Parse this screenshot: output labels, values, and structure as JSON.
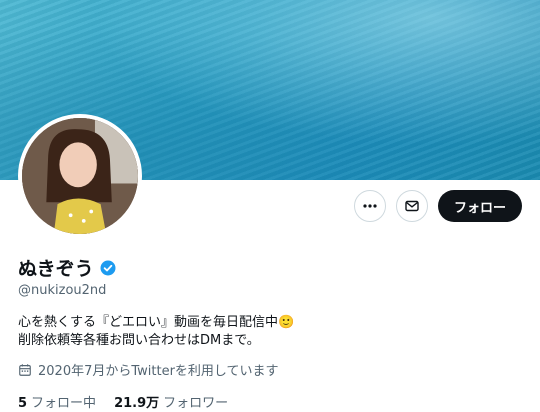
{
  "profile": {
    "display_name": "ぬきぞう",
    "verified": true,
    "handle": "@nukizou2nd",
    "bio_line1": "心を熱くする『どエロい』動画を毎日配信中",
    "bio_emoji": "🙂",
    "bio_line2": "削除依頼等各種お問い合わせはDMまで。",
    "joined": "2020年7月からTwitterを利用しています"
  },
  "actions": {
    "more_icon": "more-horizontal-icon",
    "message_icon": "mail-icon",
    "follow_label": "フォロー"
  },
  "stats": {
    "following_count": "5",
    "following_label": "フォロー中",
    "followers_count": "21.9万",
    "followers_label": "フォロワー"
  },
  "colors": {
    "verified_badge": "#1d9bf0",
    "follow_button_bg": "#0f1419",
    "secondary_text": "#536471",
    "banner": "#2aa0c7"
  }
}
